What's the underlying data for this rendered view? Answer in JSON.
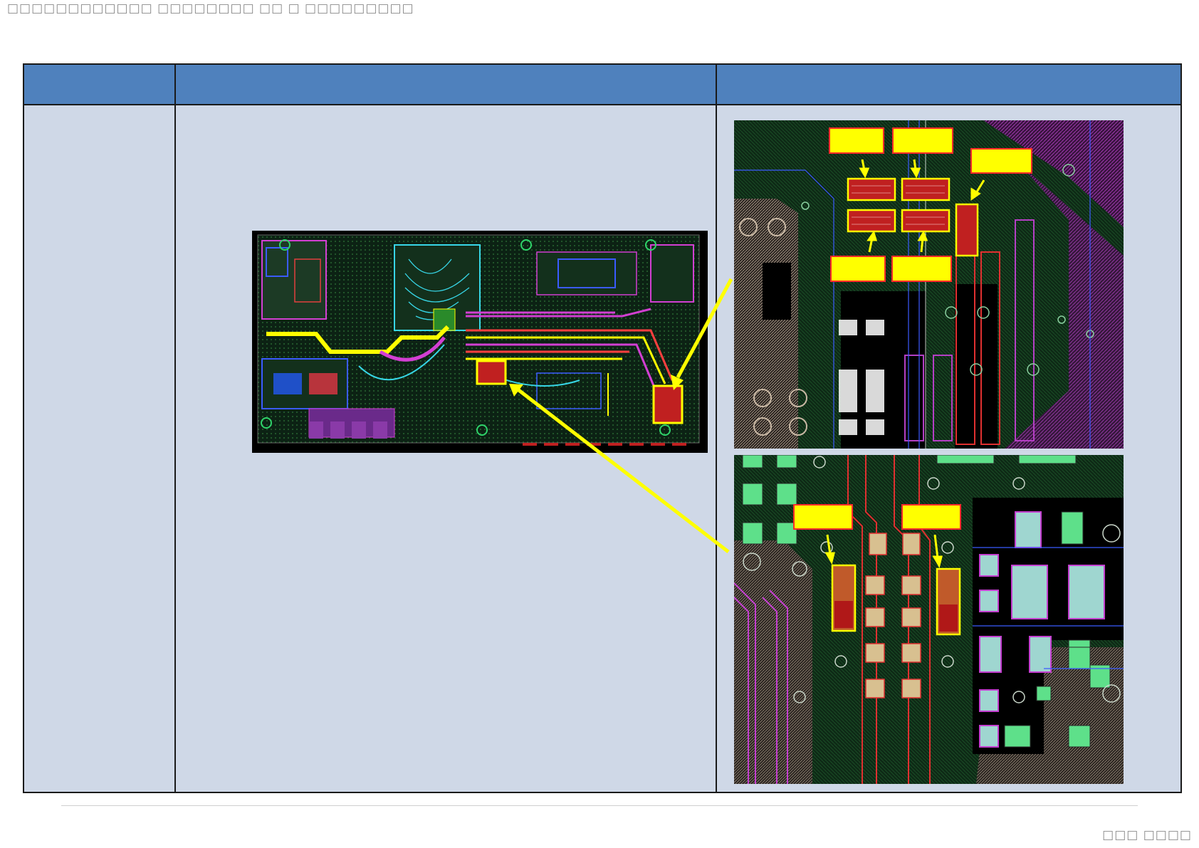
{
  "header_text": "□□□□□□□□□□□□ □□□□□□□□ □□ □ □□□□□□□□□",
  "footer_text": "□□□ □□□□",
  "table": {
    "headers": [
      "",
      "",
      ""
    ],
    "row": {
      "cell_1": "",
      "cell_2": ""
    }
  },
  "colors": {
    "header_fill": "#4f81bd",
    "cell_fill": "#cfd8e7",
    "highlight": "#ffff00",
    "pad_red": "#b01818",
    "board": "#0b1a0f"
  },
  "callouts_top": [
    "",
    "",
    "",
    "",
    ""
  ],
  "callouts_bottom": [
    "",
    ""
  ]
}
